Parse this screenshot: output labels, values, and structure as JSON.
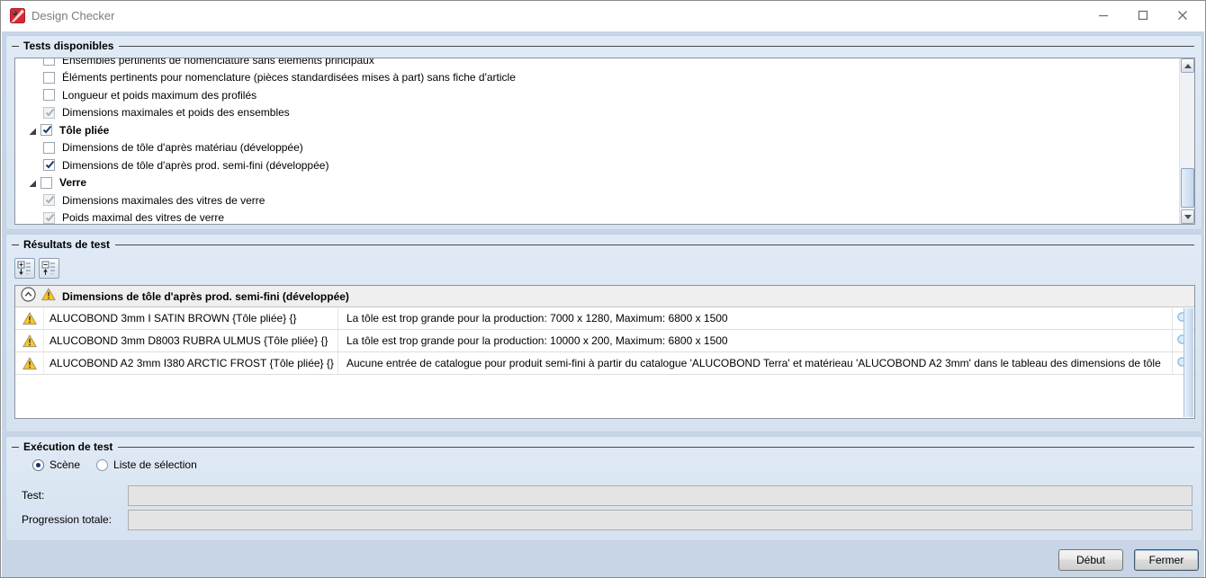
{
  "window": {
    "title": "Design Checker"
  },
  "icons": {
    "app": "design-checker-logo",
    "minimize": "minimize-glyph",
    "maximize": "maximize-glyph",
    "close": "x-glyph",
    "warning": "yellow-warning-triangle",
    "magnifier": "zoom-magnifier",
    "collapse_circle": "circled-chevron-up",
    "expand_all": "plus-box-down-arrow-list",
    "collapse_all": "minus-box-up-arrow-list",
    "tree_expanded": "black-corner-triangle"
  },
  "tests_section": {
    "title": "Tests disponibles",
    "items": [
      {
        "label": "Ensembles pertinents de nomenclature sans éléments principaux",
        "level": "child",
        "checked": false,
        "disabled": false,
        "bold": false,
        "clipped": true
      },
      {
        "label": "Éléments pertinents pour nomenclature (pièces standardisées mises à part) sans fiche d'article",
        "level": "child",
        "checked": false,
        "disabled": false,
        "bold": false,
        "clipped": false
      },
      {
        "label": "Longueur et poids maximum des profilés",
        "level": "child",
        "checked": false,
        "disabled": false,
        "bold": false,
        "clipped": false
      },
      {
        "label": "Dimensions maximales et poids des ensembles",
        "level": "child",
        "checked": true,
        "disabled": true,
        "bold": false,
        "clipped": false
      },
      {
        "label": "Tôle pliée",
        "level": "parent",
        "checked": true,
        "disabled": false,
        "bold": true,
        "clipped": false
      },
      {
        "label": "Dimensions de tôle d'après matériau (développée)",
        "level": "child",
        "checked": false,
        "disabled": false,
        "bold": false,
        "clipped": false
      },
      {
        "label": "Dimensions de tôle d'après prod. semi-fini (développée)",
        "level": "child",
        "checked": true,
        "disabled": false,
        "bold": false,
        "clipped": false
      },
      {
        "label": "Verre",
        "level": "parent",
        "checked": false,
        "disabled": false,
        "bold": true,
        "clipped": false
      },
      {
        "label": "Dimensions maximales des vitres de verre",
        "level": "child",
        "checked": true,
        "disabled": true,
        "bold": false,
        "clipped": false
      },
      {
        "label": "Poids maximal des vitres de verre",
        "level": "child",
        "checked": true,
        "disabled": true,
        "bold": false,
        "clipped": false
      }
    ]
  },
  "results_section": {
    "title": "Résultats de test",
    "group_header": "Dimensions de tôle d'après prod. semi-fini (développée)",
    "rows": [
      {
        "name": "ALUCOBOND 3mm I SATIN BROWN {Tôle pliée} {}",
        "message": "La tôle est trop grande pour la production: 7000 x 1280, Maximum: 6800 x 1500"
      },
      {
        "name": "ALUCOBOND 3mm D8003 RUBRA ULMUS {Tôle pliée} {}",
        "message": "La tôle est trop grande pour la production: 10000 x 200, Maximum: 6800 x 1500"
      },
      {
        "name": "ALUCOBOND A2 3mm I380 ARCTIC FROST {Tôle pliée} {}",
        "message": "Aucune entrée de catalogue pour produit semi-fini à partir du catalogue 'ALUCOBOND Terra' et matérieau 'ALUCOBOND A2 3mm' dans le tableau des dimensions de tôle"
      }
    ]
  },
  "execution_section": {
    "title": "Exécution de test",
    "radios": [
      {
        "label": "Scène",
        "selected": true
      },
      {
        "label": "Liste de sélection",
        "selected": false
      }
    ],
    "fields": [
      {
        "label": "Test:",
        "value": ""
      },
      {
        "label": "Progression totale:",
        "value": ""
      }
    ]
  },
  "footer": {
    "start": "Début",
    "close": "Fermer"
  },
  "colors": {
    "dialog_bg": "#d6e2f0",
    "accent_check": "#1b3a68",
    "warning_yellow": "#ffc61a",
    "panel_white": "#ffffff"
  }
}
